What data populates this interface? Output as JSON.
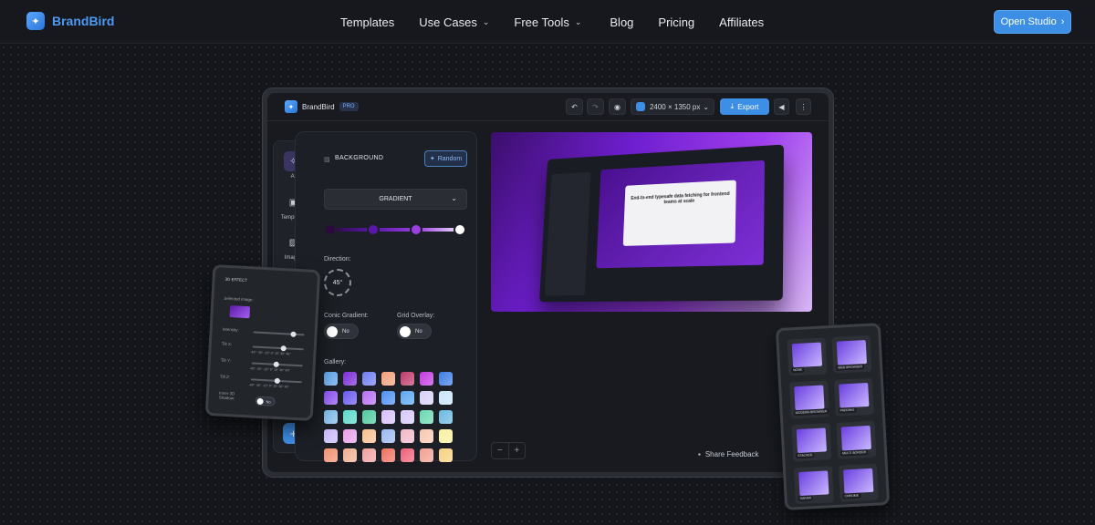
{
  "brand": {
    "name": "BrandBird"
  },
  "nav": {
    "templates": "Templates",
    "use_cases": "Use Cases",
    "free_tools": "Free Tools",
    "blog": "Blog",
    "pricing": "Pricing",
    "affiliates": "Affiliates",
    "open_studio": "Open Studio"
  },
  "app": {
    "name": "BrandBird",
    "badge": "PRO",
    "size": "2400 × 1350 px",
    "export": "Export",
    "sidebar": {
      "ai": "AI",
      "templates": "Templates",
      "images": "Images"
    },
    "panel": {
      "title": "BACKGROUND",
      "random": "Random",
      "gradient_type": "GRADIENT",
      "direction_label": "Direction:",
      "direction_value": "45°",
      "conic_label": "Conic Gradient:",
      "conic_value": "No",
      "grid_label": "Grid Overlay:",
      "grid_value": "No",
      "gallery_label": "Gallery:"
    },
    "gradient_stops": [
      "#2a0a3f",
      "#5a18a8",
      "#9b3fe0",
      "#ffffff"
    ],
    "gallery": [
      [
        "#5aa0e8",
        "#7b2bd6",
        "#6f7ef0",
        "#f0a07a",
        "#c03a6a",
        "#c33ae0",
        "#3d7de6"
      ],
      [
        "#8a4ef0",
        "#6a58f0",
        "#b76ef0",
        "#4d8ff0",
        "#5aa6f0",
        "#d8d0f8",
        "#c9e4f8"
      ],
      [
        "#7ab8e8",
        "#5ad8c8",
        "#4ec8a0",
        "#d8c0f8",
        "#d8c8f8",
        "#6ad8b0",
        "#6ab8e0"
      ],
      [
        "#c8b8f8",
        "#e8a0e8",
        "#f8c090",
        "#9ab8f0",
        "#f0b8c8",
        "#f8c8b0",
        "#f8f0a0"
      ],
      [
        "#f09070",
        "#f0b090",
        "#f0a0a0",
        "#f07060",
        "#f06078",
        "#f0a090",
        "#f8d080"
      ]
    ],
    "preview_headline": "End-to-end typesafe data fetching for frontend teams at scale",
    "feedback": "Share Feedback"
  },
  "effect_card": {
    "title": "3D EFFECT",
    "selected_image": "Selected image:",
    "intensity": "Intensity:",
    "tilt_x": "Tilt X:",
    "tilt_y": "Tilt Y:",
    "tilt_z": "Tilt Z:",
    "tilt_scale": "-45° -30° -15° 0° 15° 30° 45°",
    "inner_shadow": "Inner 3D Shadow:",
    "shadow_value": "No"
  },
  "frames_card": {
    "labels": [
      "NONE",
      "WEB BROWSER",
      "MODERN BROWSER",
      "PADDING",
      "STACKED",
      "MULTI BORDER",
      "SAFARI",
      "CHROME"
    ]
  }
}
